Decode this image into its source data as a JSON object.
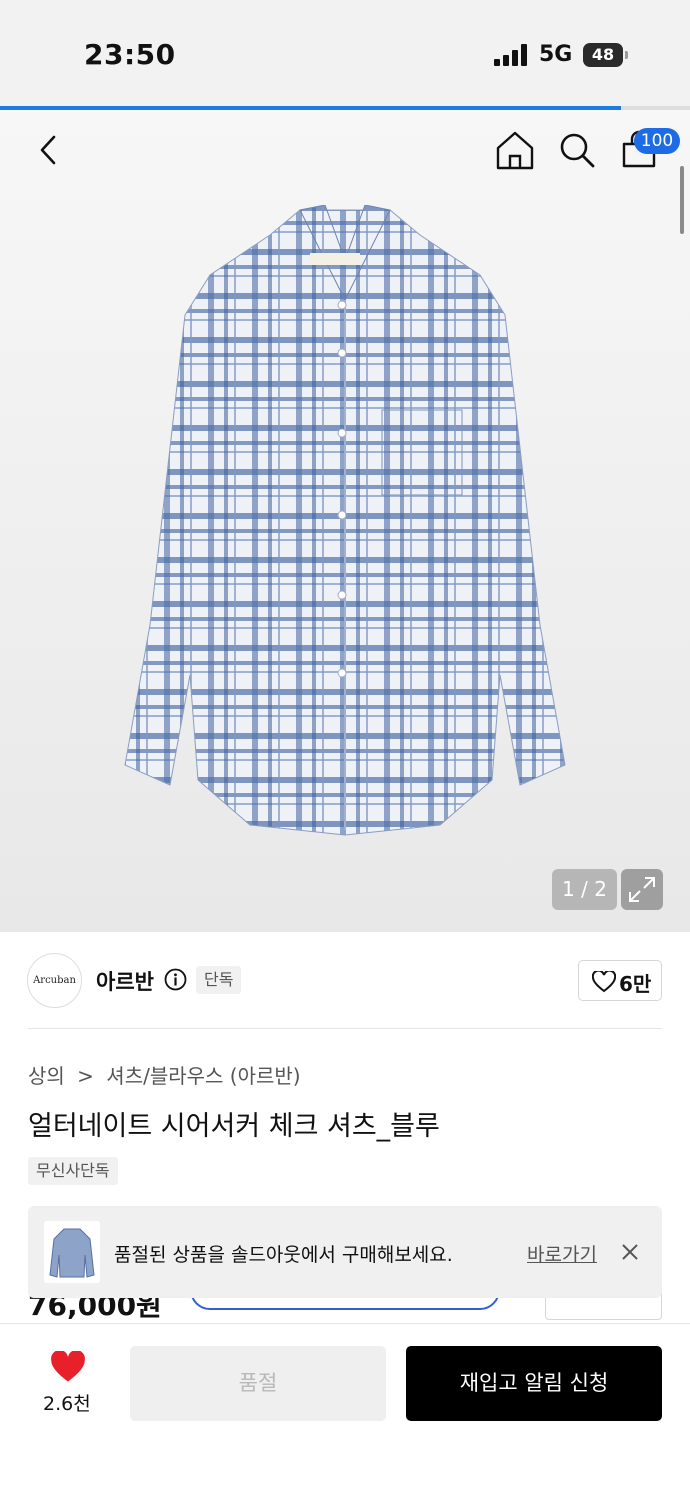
{
  "status_bar": {
    "time": "23:50",
    "network": "5G",
    "battery": "48"
  },
  "page_load_progress": 0.9,
  "nav": {
    "cart_badge": "100",
    "icons": [
      "back-icon",
      "home-icon",
      "search-icon",
      "cart-icon"
    ]
  },
  "gallery": {
    "counter": "1 / 2",
    "expand_icon": "expand-icon"
  },
  "brand": {
    "logo_text": "Arcuban",
    "name": "아르반",
    "tag": "단독",
    "likes": "6만"
  },
  "breadcrumb": {
    "category": "상의",
    "separator": ">",
    "subcategory": "셔츠/블라우스 (아르반)"
  },
  "product": {
    "title": "얼터네이트 시어서커 체크 셔츠_블루",
    "badge": "무신사단독",
    "price": "76,000원"
  },
  "toast": {
    "message": "품절된 상품을 솔드아웃에서 구매해보세요.",
    "link": "바로가기"
  },
  "bottom_bar": {
    "wish_count": "2.6천",
    "soldout_label": "품절",
    "restock_label": "재입고 알림 신청"
  },
  "colors": {
    "accent": "#1e6be6",
    "heart": "#e8202a",
    "black": "#000000"
  }
}
